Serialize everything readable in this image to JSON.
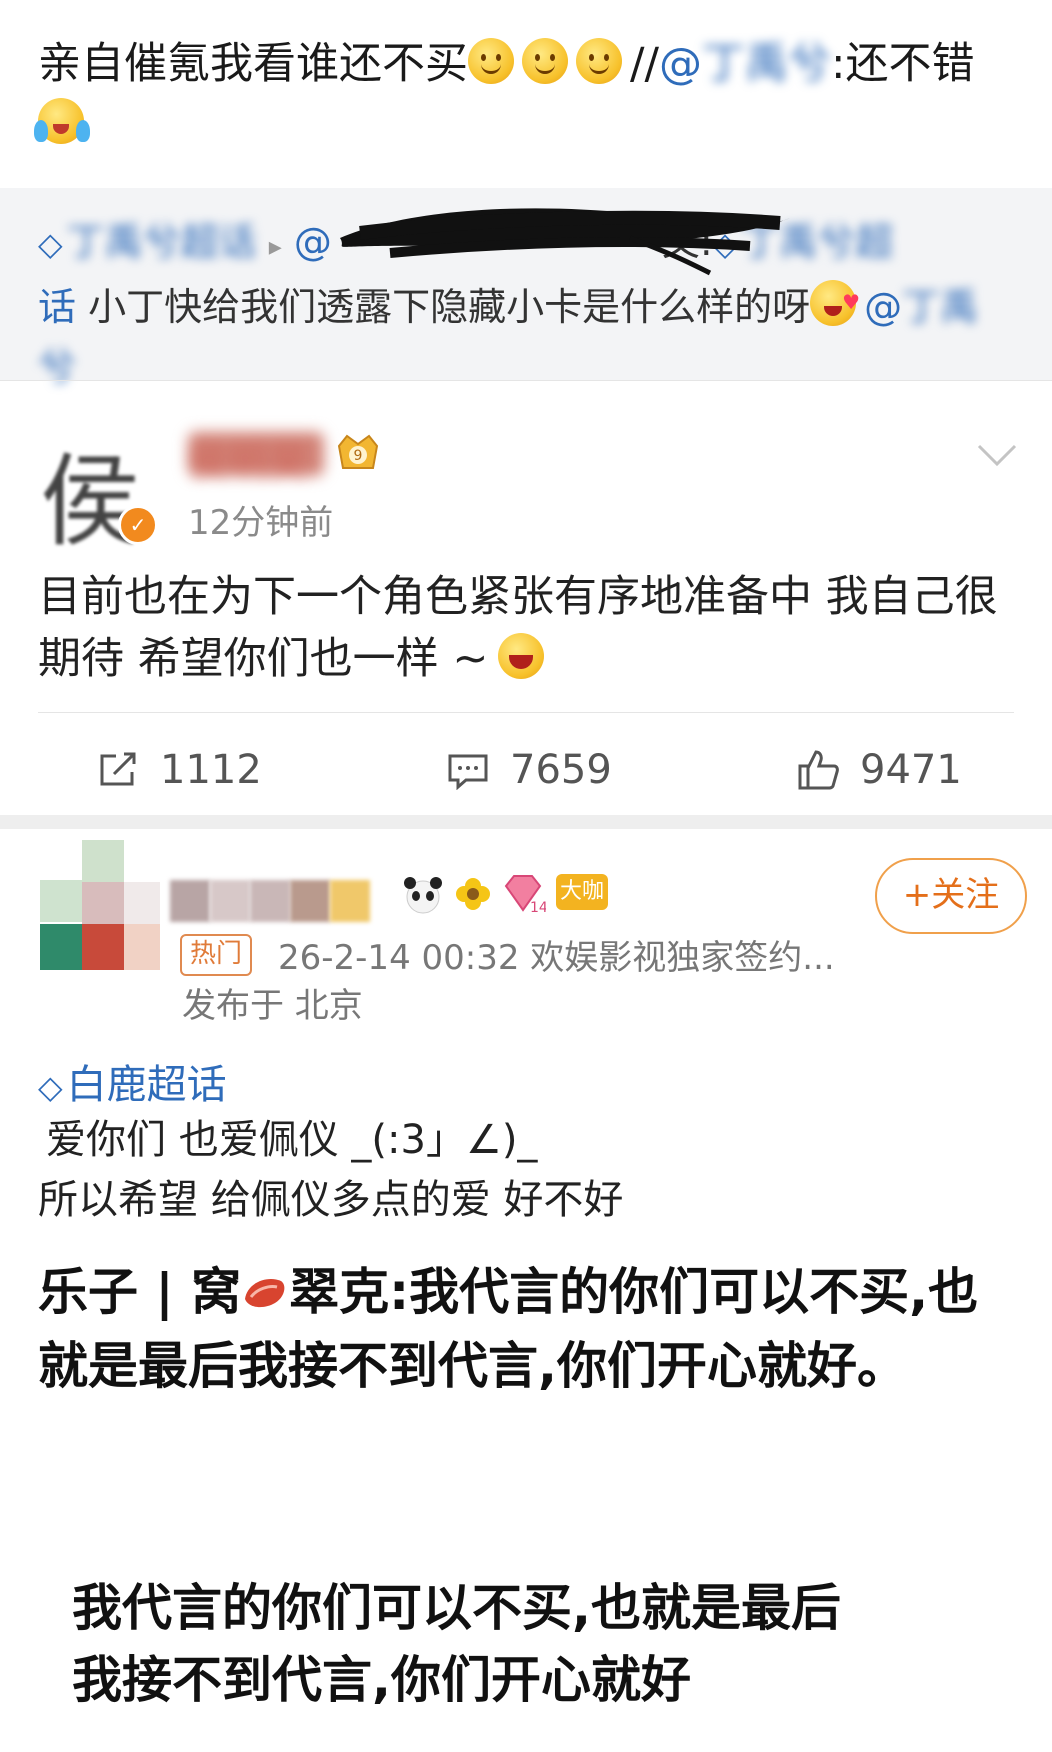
{
  "top_post": {
    "text_before": "亲自催氪我看谁还不买",
    "repost_sep": "//",
    "mention_at": "@",
    "mention_name": "丁禹兮",
    "text_after": ":还不错"
  },
  "repost": {
    "supertopic_name": "丁禹兮超话",
    "mention_at": "@",
    "line_middle": "文:",
    "supertopic2_head": "丁禹兮超",
    "supertopic2_tail": "话",
    "message": "小丁快给我们透露下隐藏小卡是什么样的呀",
    "mention_tail_at": "@",
    "mention_tail_name": "丁禹兮"
  },
  "middle_post": {
    "avatar_char": "侯",
    "user_name": "侯明昊",
    "crown_level": "9",
    "time": "12分钟前",
    "body": "目前也在为下一个角色紧张有序地准备中  我自己很期待  希望你们也一样 ~",
    "repost_count": "1112",
    "comment_count": "7659",
    "like_count": "9471"
  },
  "bottom_post": {
    "badge_level": "14",
    "badge_label": "大咖",
    "follow_label": "+关注",
    "hot_label": "热门",
    "meta": "26-2-14 00:32  欢娱影视独家签约...",
    "location": "发布于 北京",
    "supertopic": "白鹿超话",
    "line1": "爱你们 也爱佩仪 _(:3」∠)_",
    "line2": "所以希望 给佩仪多点的爱 好不好"
  },
  "quote": {
    "prefix": "乐子 | 窝",
    "suffix": "翠克:我代言的你们可以不买,也就是最后我接不到代言,你们开心就好。"
  },
  "lower_quote": {
    "line1": "我代言的你们可以不买,也就是最后",
    "line2": "我接不到代言,你们开心就好"
  },
  "colors": {
    "link": "#2f6cba",
    "accent_orange": "#e46f1a",
    "repost_bg": "#f3f4f6"
  },
  "icons": [
    "smile-emoji",
    "cry-emoji",
    "diamond-icon",
    "love-emoji",
    "verified-icon",
    "crown-icon",
    "chevron-down-icon",
    "repost-icon",
    "comment-icon",
    "like-icon",
    "panda-icon",
    "flower-icon",
    "gem-icon",
    "meat-icon"
  ]
}
